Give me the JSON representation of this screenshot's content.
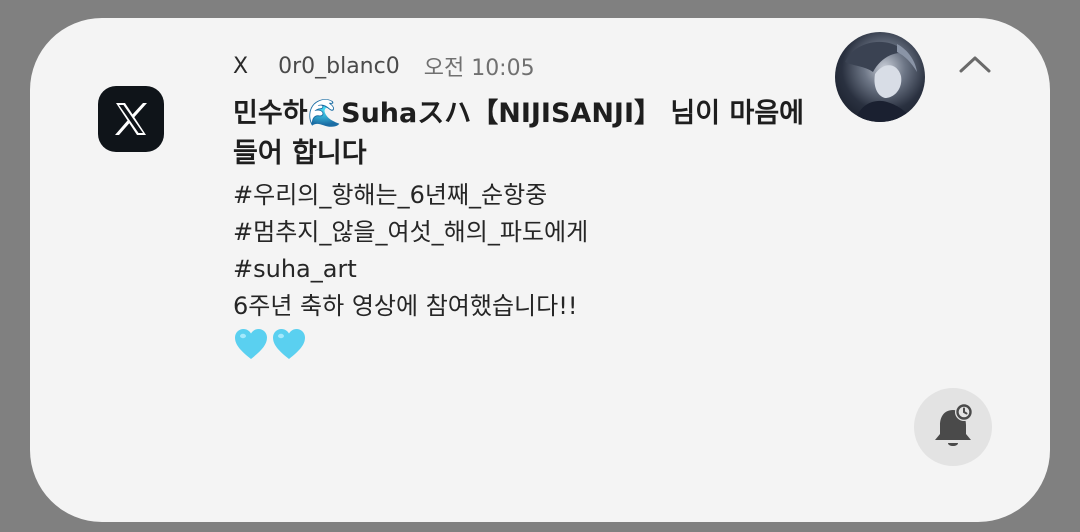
{
  "notification": {
    "app_name": "X",
    "sender": "0r0_blanc0",
    "time": "오전 10:05",
    "title": "민수하🌊Suhaスハ【NIJISANJI】 님이 마음에 들어 합니다",
    "body_lines": [
      "#우리의_항해는_6년째_순항중",
      "#멈추지_않을_여섯_해의_파도에게",
      "#suha_art",
      "6주년 축하 영상에 참여했습니다!!"
    ],
    "emoji_hearts": [
      "🩵",
      "🩵"
    ],
    "heart_color": "#5ad0f0"
  },
  "icons": {
    "app": "x-logo-icon",
    "collapse": "chevron-up-icon",
    "bell": "bell-snooze-icon",
    "avatar": "avatar"
  },
  "colors": {
    "background": "#808080",
    "card": "#f4f4f4",
    "app_icon_bg": "#0f1419",
    "bell_bg": "#e3e3e3"
  }
}
